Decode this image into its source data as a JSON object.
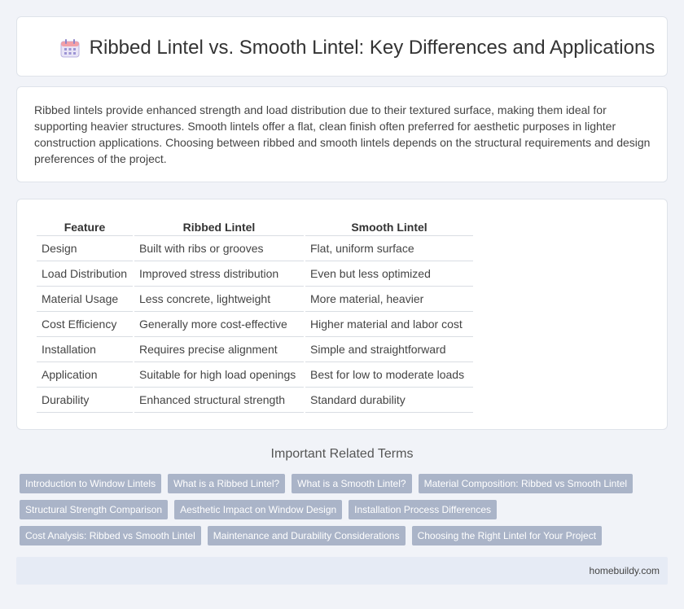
{
  "header": {
    "title": "Ribbed Lintel vs. Smooth Lintel: Key Differences and Applications",
    "icon": "calendar-icon"
  },
  "intro": {
    "text": "Ribbed lintels provide enhanced strength and load distribution due to their textured surface, making them ideal for supporting heavier structures. Smooth lintels offer a flat, clean finish often preferred for aesthetic purposes in lighter construction applications. Choosing between ribbed and smooth lintels depends on the structural requirements and design preferences of the project."
  },
  "table": {
    "headers": [
      "Feature",
      "Ribbed Lintel",
      "Smooth Lintel"
    ],
    "rows": [
      [
        "Design",
        "Built with ribs or grooves",
        "Flat, uniform surface"
      ],
      [
        "Load Distribution",
        "Improved stress distribution",
        "Even but less optimized"
      ],
      [
        "Material Usage",
        "Less concrete, lightweight",
        "More material, heavier"
      ],
      [
        "Cost Efficiency",
        "Generally more cost-effective",
        "Higher material and labor cost"
      ],
      [
        "Installation",
        "Requires precise alignment",
        "Simple and straightforward"
      ],
      [
        "Application",
        "Suitable for high load openings",
        "Best for low to moderate loads"
      ],
      [
        "Durability",
        "Enhanced structural strength",
        "Standard durability"
      ]
    ]
  },
  "related": {
    "title": "Important Related Terms",
    "rows": [
      [
        "Introduction to Window Lintels",
        "What is a Ribbed Lintel?",
        "What is a Smooth Lintel?",
        "Material Composition: Ribbed vs Smooth Lintel"
      ],
      [
        "Structural Strength Comparison",
        "Aesthetic Impact on Window Design",
        "Installation Process Differences"
      ],
      [
        "Cost Analysis: Ribbed vs Smooth Lintel",
        "Maintenance and Durability Considerations",
        "Choosing the Right Lintel for Your Project"
      ]
    ]
  },
  "footer": {
    "site": "homebuildy.com"
  },
  "colors": {
    "tag_bg": "#aab4c8",
    "footer_bg": "#e6ebf5",
    "page_bg": "#f1f3f8"
  }
}
